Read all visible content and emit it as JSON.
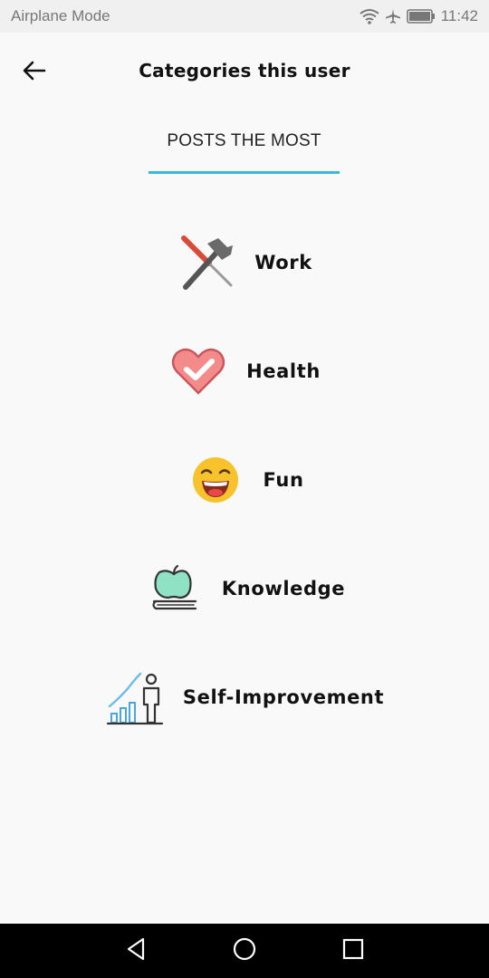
{
  "status_bar": {
    "left_text": "Airplane Mode",
    "time": "11:42",
    "icons": [
      "wifi-icon",
      "airplane-icon",
      "battery-icon"
    ]
  },
  "header": {
    "back_icon": "arrow-left-icon",
    "title": "Categories this user"
  },
  "tab": {
    "label": "POSTS THE MOST",
    "underline_color": "#3fb6dc"
  },
  "categories": [
    {
      "label": "Work",
      "icon": "hammer-screwdriver-icon"
    },
    {
      "label": "Health",
      "icon": "heart-check-icon"
    },
    {
      "label": "Fun",
      "icon": "laughing-face-icon"
    },
    {
      "label": "Knowledge",
      "icon": "apple-on-book-icon"
    },
    {
      "label": "Self-Improvement",
      "icon": "growth-chart-person-icon"
    }
  ],
  "nav_bar": {
    "buttons": [
      "back-triangle-icon",
      "home-circle-icon",
      "recents-square-icon"
    ]
  }
}
